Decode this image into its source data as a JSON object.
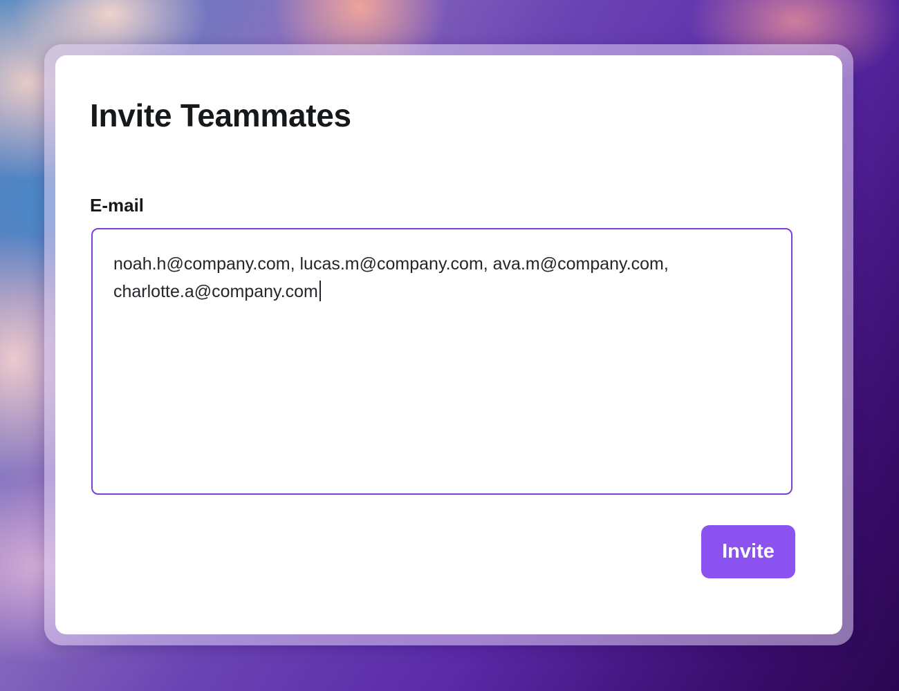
{
  "dialog": {
    "title": "Invite Teammates",
    "email_label": "E-mail",
    "email_value": "noah.h@company.com, lucas.m@company.com, ava.m@company.com, charlotte.a@company.com",
    "invite_label": "Invite"
  },
  "colors": {
    "accent": "#8c52f0",
    "input_border": "#7a3fd6",
    "text": "#16191b"
  }
}
